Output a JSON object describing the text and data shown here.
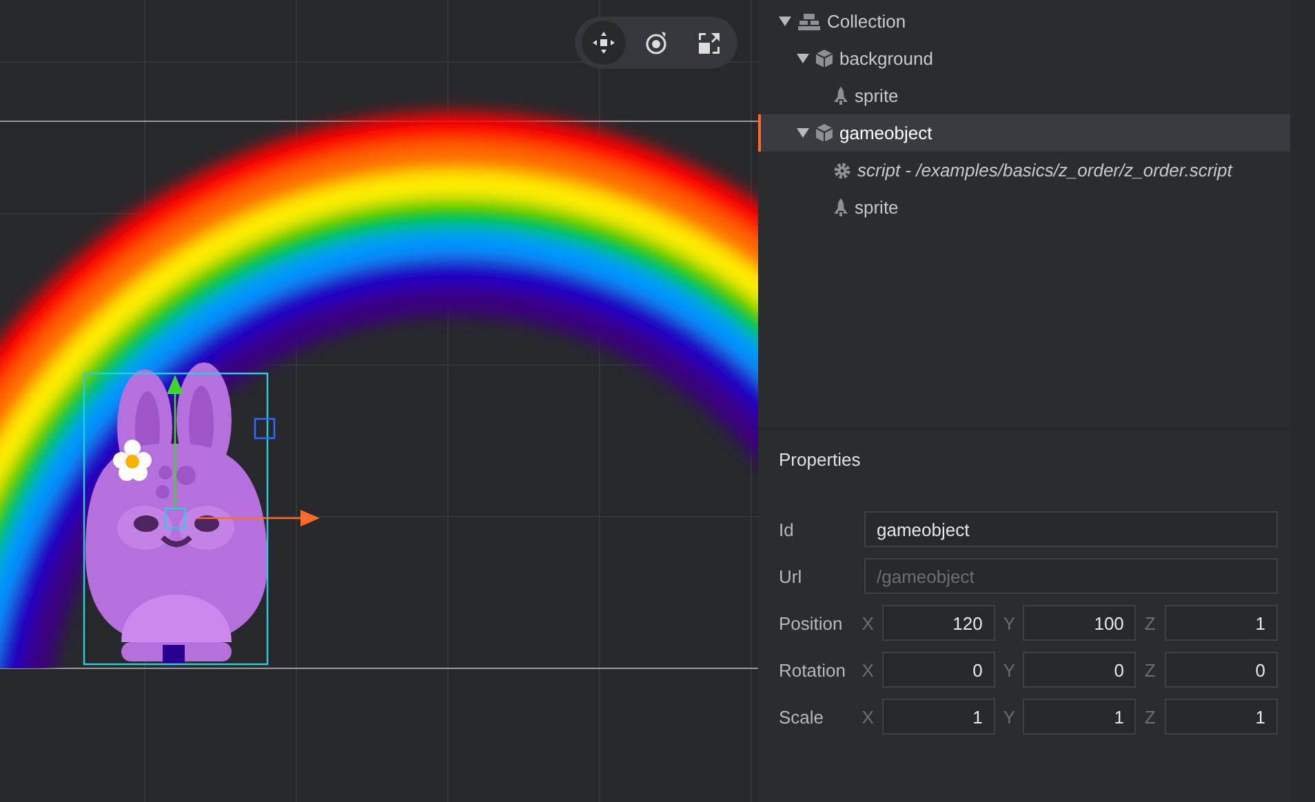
{
  "viewport": {
    "tools": [
      {
        "kind": "move",
        "selected": true
      },
      {
        "kind": "rotate",
        "selected": false
      },
      {
        "kind": "scale",
        "selected": false
      }
    ]
  },
  "outline": {
    "items": [
      {
        "kind": "collection",
        "label": "Collection",
        "expanded": true,
        "selected": false,
        "children": [
          {
            "kind": "gameobject",
            "label": "background",
            "expanded": true,
            "selected": false,
            "children": [
              {
                "kind": "sprite",
                "label": "sprite",
                "selected": false
              }
            ]
          },
          {
            "kind": "gameobject",
            "label": "gameobject",
            "expanded": true,
            "selected": true,
            "children": [
              {
                "kind": "script",
                "label": "script - /examples/basics/z_order/z_order.script",
                "selected": false
              },
              {
                "kind": "sprite",
                "label": "sprite",
                "selected": false
              }
            ]
          }
        ]
      }
    ]
  },
  "properties": {
    "title": "Properties",
    "rows": [
      {
        "kind": "text",
        "label": "Id",
        "value": "gameobject"
      },
      {
        "kind": "text",
        "label": "Url",
        "placeholder": "/gameobject"
      },
      {
        "kind": "vector",
        "label": "Position",
        "fields": [
          {
            "axis": "X",
            "value": "120"
          },
          {
            "axis": "Y",
            "value": "100"
          },
          {
            "axis": "Z",
            "value": "1"
          }
        ]
      },
      {
        "kind": "vector",
        "label": "Rotation",
        "fields": [
          {
            "axis": "X",
            "value": "0"
          },
          {
            "axis": "Y",
            "value": "0"
          },
          {
            "axis": "Z",
            "value": "0"
          }
        ]
      },
      {
        "kind": "vector",
        "label": "Scale",
        "fields": [
          {
            "axis": "X",
            "value": "1"
          },
          {
            "axis": "Y",
            "value": "1"
          },
          {
            "axis": "Z",
            "value": "1"
          }
        ]
      }
    ]
  }
}
